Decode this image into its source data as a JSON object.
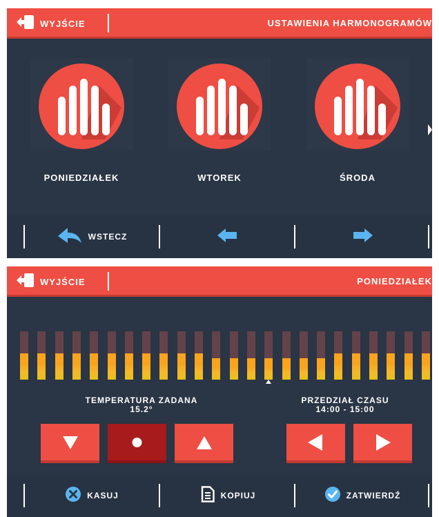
{
  "colors": {
    "panel_bg": "#2a3545",
    "header_bg": "#ee4e43",
    "accent_blue": "#5ab4f0",
    "bar_fill": "#ffa31f",
    "bar_empty": "#64424a",
    "button_red": "#ee4e43",
    "button_dark": "#a71b1c"
  },
  "screen1": {
    "header": {
      "exit_label": "WYJŚCIE",
      "title": "USTAWIENIA HARMONOGRAMÓW",
      "exit_icon": "exit-icon"
    },
    "days": [
      {
        "label": "PONIEDZIAŁEK",
        "icon": "bar-chart-icon"
      },
      {
        "label": "WTOREK",
        "icon": "bar-chart-icon"
      },
      {
        "label": "ŚRODA",
        "icon": "bar-chart-icon"
      }
    ],
    "footer": {
      "back_label": "WSTECZ",
      "back_icon": "back-arrow-icon",
      "prev_icon": "arrow-left-icon",
      "next_icon": "arrow-right-icon"
    }
  },
  "screen2": {
    "header": {
      "exit_label": "WYJŚCIE",
      "title": "PONIEDZIAŁEK",
      "exit_icon": "exit-icon"
    },
    "schedule": {
      "hours": 24,
      "selected_hour": 14,
      "fill_levels": [
        0.54,
        0.54,
        0.54,
        0.54,
        0.54,
        0.54,
        0.54,
        0.54,
        0.54,
        0.54,
        0.54,
        0.44,
        0.44,
        0.44,
        0.44,
        0.44,
        0.44,
        0.44,
        0.54,
        0.54,
        0.54,
        0.54,
        0.54,
        0.54
      ]
    },
    "temperature": {
      "title": "TEMPERATURA ZADANA",
      "value": "15.2°"
    },
    "interval": {
      "title": "PRZEDZIAŁ CZASU",
      "value": "14:00 - 15:00"
    },
    "controls": {
      "down_icon": "triangle-down-icon",
      "dot_icon": "dot-icon",
      "up_icon": "triangle-up-icon",
      "left_icon": "triangle-left-icon",
      "right_icon": "triangle-right-icon"
    },
    "footer": {
      "cancel_label": "KASUJ",
      "copy_label": "KOPIUJ",
      "confirm_label": "ZATWIERDŹ",
      "cancel_icon": "x-circle-icon",
      "copy_icon": "document-icon",
      "confirm_icon": "check-circle-icon"
    }
  }
}
